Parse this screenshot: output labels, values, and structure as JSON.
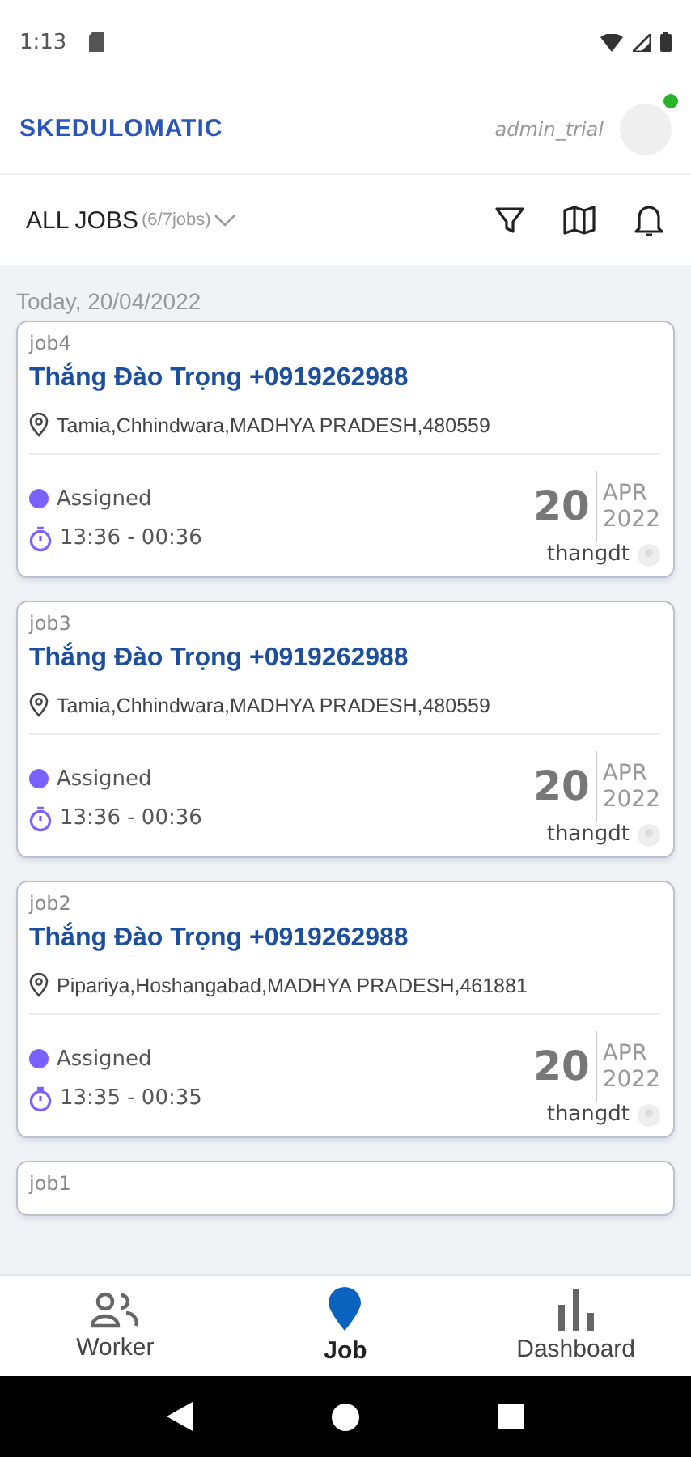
{
  "status_bar": {
    "time": "1:13"
  },
  "header": {
    "brand": "SKEDULOMATIC",
    "user": "admin_trial",
    "online": true
  },
  "toolbar": {
    "title": "ALL JOBS",
    "count": "(6/7jobs)"
  },
  "date_heading": "Today, 20/04/2022",
  "jobs": [
    {
      "code": "job4",
      "title": "Thắng Đào Trọng +0919262988",
      "address": "Tamia,Chhindwara,MADHYA PRADESH,480559",
      "status": "Assigned",
      "color": "#7b61ff",
      "time": "13:36 - 00:36",
      "day": "20",
      "month": "APR",
      "year": "2022",
      "worker": "thangdt"
    },
    {
      "code": "job3",
      "title": "Thắng Đào Trọng +0919262988",
      "address": "Tamia,Chhindwara,MADHYA PRADESH,480559",
      "status": "Assigned",
      "color": "#7b61ff",
      "time": "13:36 - 00:36",
      "day": "20",
      "month": "APR",
      "year": "2022",
      "worker": "thangdt"
    },
    {
      "code": "job2",
      "title": "Thắng Đào Trọng +0919262988",
      "address": "Pipariya,Hoshangabad,MADHYA PRADESH,461881",
      "status": "Assigned",
      "color": "#7b61ff",
      "time": "13:35 - 00:35",
      "day": "20",
      "month": "APR",
      "year": "2022",
      "worker": "thangdt"
    },
    {
      "code": "job1"
    }
  ],
  "nav": [
    {
      "label": "Worker",
      "kind": "worker",
      "selected": false
    },
    {
      "label": "Job",
      "kind": "job",
      "selected": true
    },
    {
      "label": "Dashboard",
      "kind": "dashboard",
      "selected": false
    }
  ]
}
